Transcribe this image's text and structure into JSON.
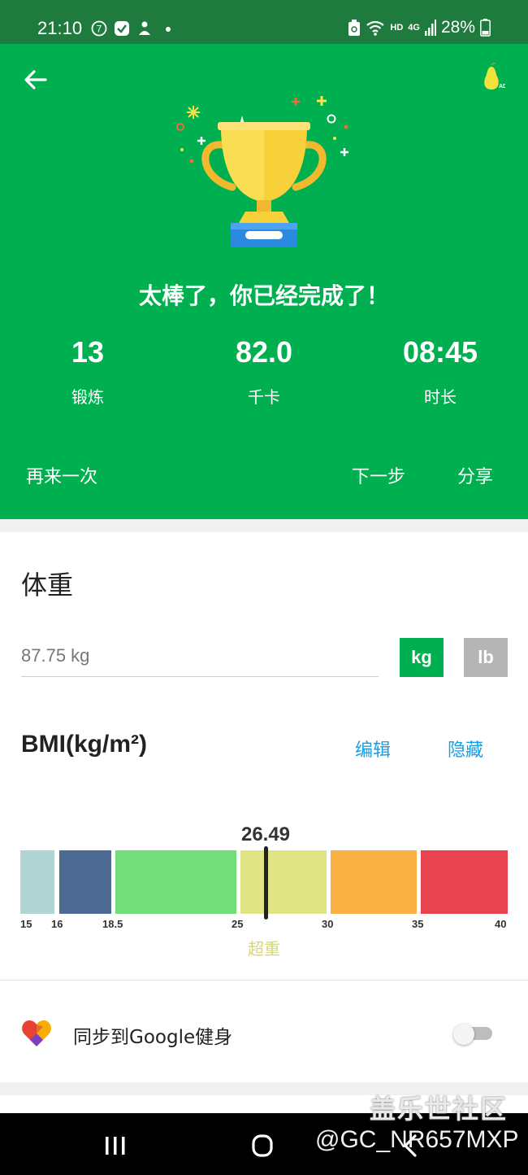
{
  "status_bar": {
    "time": "21:10",
    "battery": "28%",
    "network_hd": "HD",
    "network_4g": "4G",
    "icons": [
      "notification-7-icon",
      "check-app-icon",
      "baby-icon",
      "dot-icon",
      "recycle-battery-icon",
      "wifi-icon",
      "signal-icon",
      "battery-icon"
    ]
  },
  "hero": {
    "title": "太棒了，你已经完成了！",
    "stats": [
      {
        "value": "13",
        "label": "锻炼"
      },
      {
        "value": "82.0",
        "label": "千卡"
      },
      {
        "value": "08:45",
        "label": "时长"
      }
    ],
    "actions": {
      "again": "再来一次",
      "next": "下一步",
      "share": "分享"
    },
    "background_color": "#00b050"
  },
  "weight": {
    "title": "体重",
    "input_value": "87.75 kg",
    "unit_kg": "kg",
    "unit_lb": "lb",
    "selected_unit": "kg"
  },
  "bmi": {
    "title": "BMI(kg/m²)",
    "edit": "编辑",
    "hide": "隐藏",
    "value": "26.49",
    "category": "超重",
    "ticks": [
      "15",
      "16",
      "18.5",
      "25",
      "30",
      "35",
      "40"
    ],
    "segments": [
      {
        "color": "#b0d4d1"
      },
      {
        "color": "#4d6a92"
      },
      {
        "color": "#74dd7b"
      },
      {
        "color": "#dfe585"
      },
      {
        "color": "#fbb244"
      },
      {
        "color": "#e8434f"
      }
    ]
  },
  "sync": {
    "label": "同步到Google健身",
    "enabled": false
  },
  "watermark": {
    "line1": "盖乐世社区",
    "line2": "@GC_NR657MXP"
  },
  "colors": {
    "accent_green": "#00b050",
    "link_blue": "#1a9ee0",
    "unit_inactive": "#b5b5b5"
  }
}
